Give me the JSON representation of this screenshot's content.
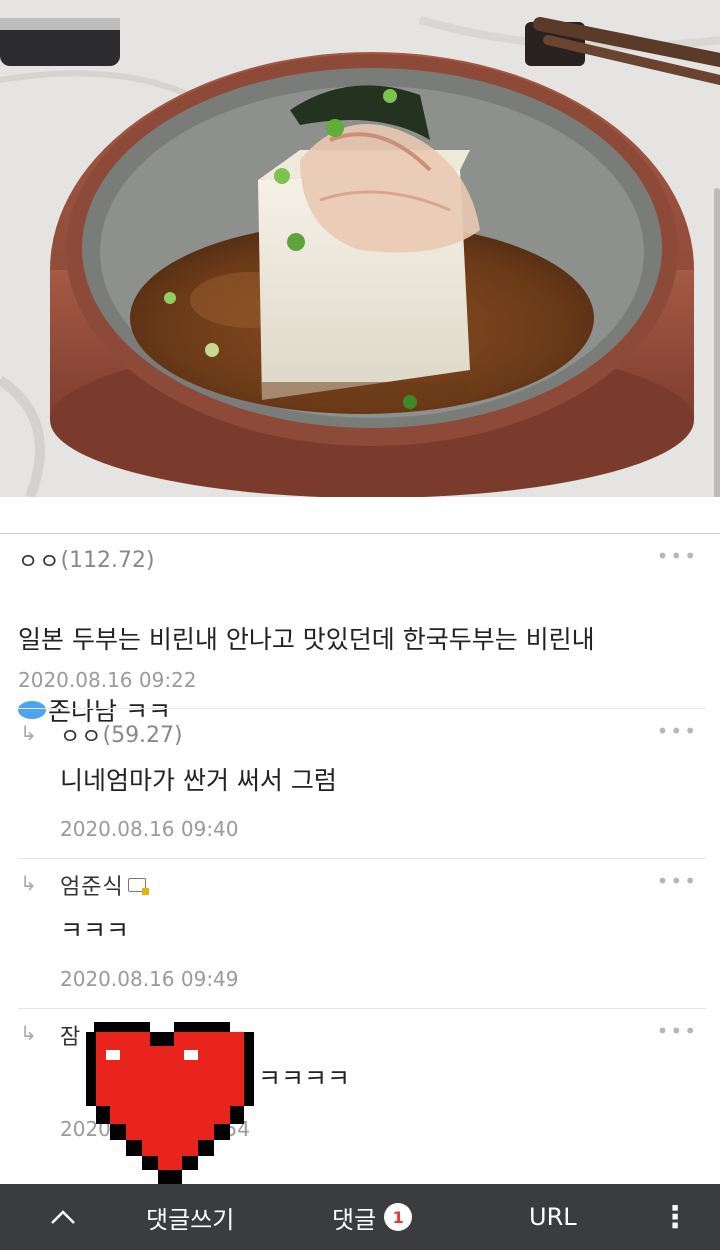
{
  "comments": [
    {
      "author": "ㅇㅇ",
      "score": "(112.72)",
      "text_line1": "일본 두부는 비린내 안나고 맛있던데 한국두부는 비린내",
      "text_line2": "존나남 ㅋㅋ",
      "time": "2020.08.16 09:22",
      "more": "•••"
    },
    {
      "reply_arrow": "↳",
      "author": "ㅇㅇ",
      "score": "(59.27)",
      "text": "니네엄마가 싼거 써서 그럼",
      "time": "2020.08.16 09:40",
      "more": "•••"
    },
    {
      "reply_arrow": "↳",
      "author": "엄준식",
      "text": "ㅋㅋㅋ",
      "time": "2020.08.16 09:49",
      "more": "•••"
    },
    {
      "reply_arrow": "↳",
      "author": "잠",
      "text": "ㅋㅋㅋㅋ",
      "time": "2020",
      "time_end": "9:54",
      "more": "•••"
    }
  ],
  "bottom_bar": {
    "collapse_icon": "^",
    "write_comment": "댓글쓰기",
    "comments_label": "댓글",
    "comments_count": "1",
    "url_label": "URL",
    "menu_icon": "⋮"
  },
  "colors": {
    "bottom_bar_bg": "#3a3c40",
    "badge_text": "#e53935",
    "heart_red": "#e8241c"
  }
}
